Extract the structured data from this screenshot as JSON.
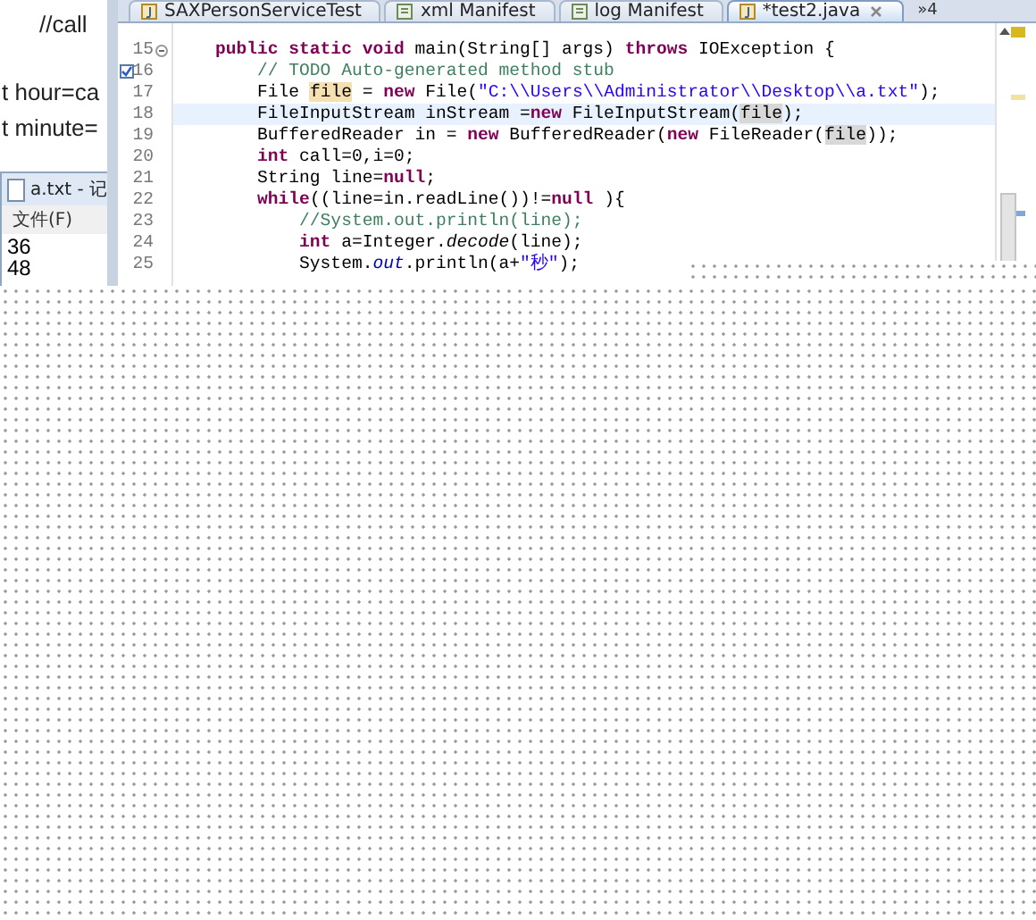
{
  "background_document": {
    "lines": [
      "//call",
      "t hour=ca",
      "t minute="
    ]
  },
  "notepad": {
    "title": "a.txt - 记",
    "menu": [
      "文件(F)"
    ],
    "lines": [
      "36",
      "48"
    ]
  },
  "editor": {
    "tabs": [
      {
        "label": "SAXPersonServiceTest",
        "kind": "java",
        "selected": false
      },
      {
        "label": "xml Manifest",
        "kind": "manifest",
        "selected": false
      },
      {
        "label": "log Manifest",
        "kind": "manifest",
        "selected": false
      },
      {
        "label": "*test2.java",
        "kind": "java",
        "selected": true
      }
    ],
    "overflow": "»4",
    "lines": [
      {
        "number": "15",
        "fold": true,
        "task": false,
        "current": false,
        "segments": [
          {
            "kind": "keyword",
            "text": "    public static void"
          },
          {
            "kind": "plain",
            "text": " main(String[] args) "
          },
          {
            "kind": "keyword",
            "text": "throws"
          },
          {
            "kind": "plain",
            "text": " IOException {"
          }
        ]
      },
      {
        "number": "16",
        "fold": false,
        "task": true,
        "current": false,
        "segments": [
          {
            "kind": "comment",
            "text": "        // TODO Auto-generated method stub"
          }
        ]
      },
      {
        "number": "17",
        "fold": false,
        "task": false,
        "current": false,
        "segments": [
          {
            "kind": "plain",
            "text": "        File "
          },
          {
            "kind": "write_occurrence",
            "text": "file"
          },
          {
            "kind": "plain",
            "text": " = "
          },
          {
            "kind": "keyword",
            "text": "new"
          },
          {
            "kind": "plain",
            "text": " File("
          },
          {
            "kind": "string",
            "text": "\"C:\\\\Users\\\\Administrator\\\\Desktop\\\\a.txt\""
          },
          {
            "kind": "plain",
            "text": ");"
          }
        ]
      },
      {
        "number": "18",
        "fold": false,
        "task": false,
        "current": true,
        "segments": [
          {
            "kind": "plain",
            "text": "        FileInputStream inStream ="
          },
          {
            "kind": "keyword",
            "text": "new"
          },
          {
            "kind": "plain",
            "text": " FileInputStream("
          },
          {
            "kind": "read_occurrence",
            "text": "file"
          },
          {
            "kind": "plain",
            "text": ");"
          }
        ]
      },
      {
        "number": "19",
        "fold": false,
        "task": false,
        "current": false,
        "segments": [
          {
            "kind": "plain",
            "text": "        BufferedReader in = "
          },
          {
            "kind": "keyword",
            "text": "new"
          },
          {
            "kind": "plain",
            "text": " BufferedReader("
          },
          {
            "kind": "keyword",
            "text": "new"
          },
          {
            "kind": "plain",
            "text": " FileReader("
          },
          {
            "kind": "read_occurrence",
            "text": "file"
          },
          {
            "kind": "plain",
            "text": "));"
          }
        ]
      },
      {
        "number": "20",
        "fold": false,
        "task": false,
        "current": false,
        "segments": [
          {
            "kind": "keyword",
            "text": "        int"
          },
          {
            "kind": "plain",
            "text": " call=0,i=0;"
          }
        ]
      },
      {
        "number": "21",
        "fold": false,
        "task": false,
        "current": false,
        "segments": [
          {
            "kind": "plain",
            "text": "        String line="
          },
          {
            "kind": "keyword",
            "text": "null"
          },
          {
            "kind": "plain",
            "text": ";"
          }
        ]
      },
      {
        "number": "22",
        "fold": false,
        "task": false,
        "current": false,
        "segments": [
          {
            "kind": "keyword",
            "text": "        while"
          },
          {
            "kind": "plain",
            "text": "((line=in.readLine())!="
          },
          {
            "kind": "keyword",
            "text": "null"
          },
          {
            "kind": "plain",
            "text": " ){"
          }
        ]
      },
      {
        "number": "23",
        "fold": false,
        "task": false,
        "current": false,
        "segments": [
          {
            "kind": "comment",
            "text": "            //System.out.println(line);"
          }
        ]
      },
      {
        "number": "24",
        "fold": false,
        "task": false,
        "current": false,
        "segments": [
          {
            "kind": "keyword",
            "text": "            int"
          },
          {
            "kind": "plain",
            "text": " a=Integer."
          },
          {
            "kind": "static_method",
            "text": "decode"
          },
          {
            "kind": "plain",
            "text": "(line);"
          }
        ]
      },
      {
        "number": "25",
        "fold": false,
        "task": false,
        "current": false,
        "segments": [
          {
            "kind": "plain",
            "text": "            System."
          },
          {
            "kind": "field",
            "text": "out"
          },
          {
            "kind": "plain",
            "text": ".println(a+"
          },
          {
            "kind": "string",
            "text": "\"秒\""
          },
          {
            "kind": "plain",
            "text": ");"
          }
        ]
      }
    ]
  }
}
